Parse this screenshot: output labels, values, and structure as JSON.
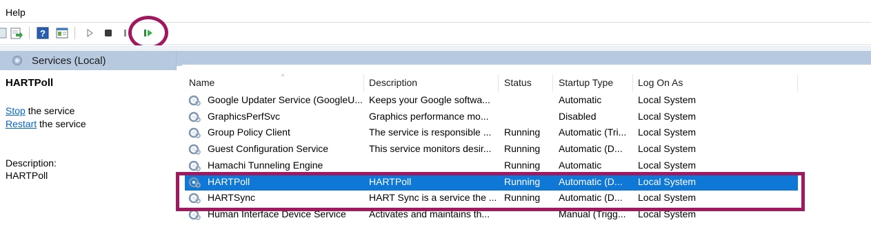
{
  "menu": {
    "help": "Help"
  },
  "toolbar": {
    "buttons": [
      "back-icon",
      "export-list-icon",
      "help-icon",
      "properties-icon",
      "start-icon",
      "stop-icon",
      "pause-icon",
      "restart-icon"
    ]
  },
  "left_pane": {
    "header": "Services (Local)",
    "selected_service": "HARTPoll",
    "stop_link": "Stop",
    "stop_rest": " the service",
    "restart_link": "Restart",
    "restart_rest": " the service",
    "description_label": "Description:",
    "description_value": "HARTPoll"
  },
  "table": {
    "columns": [
      "Name",
      "Description",
      "Status",
      "Startup Type",
      "Log On As"
    ],
    "rows": [
      {
        "name": "Google Updater Service (GoogleU...",
        "description": "Keeps your Google softwa...",
        "status": "",
        "startup": "Automatic",
        "logon": "Local System"
      },
      {
        "name": "GraphicsPerfSvc",
        "description": "Graphics performance mo...",
        "status": "",
        "startup": "Disabled",
        "logon": "Local System"
      },
      {
        "name": "Group Policy Client",
        "description": "The service is responsible ...",
        "status": "Running",
        "startup": "Automatic (Tri...",
        "logon": "Local System"
      },
      {
        "name": "Guest Configuration Service",
        "description": "This service monitors desir...",
        "status": "Running",
        "startup": "Automatic (D...",
        "logon": "Local System"
      },
      {
        "name": "Hamachi Tunneling Engine",
        "description": "",
        "status": "Running",
        "startup": "Automatic",
        "logon": "Local System"
      },
      {
        "name": "HARTPoll",
        "description": "HARTPoll",
        "status": "Running",
        "startup": "Automatic (D...",
        "logon": "Local System"
      },
      {
        "name": "HARTSync",
        "description": "HART Sync is a service the ...",
        "status": "Running",
        "startup": "Automatic (D...",
        "logon": "Local System"
      },
      {
        "name": "Human Interface Device Service",
        "description": "Activates and maintains th...",
        "status": "",
        "startup": "Manual (Trigg...",
        "logon": "Local System"
      }
    ]
  },
  "colors": {
    "selection": "#0f78d7",
    "annotation": "#a0195e",
    "header_bg": "#b7c9de",
    "link": "#0066cc"
  }
}
